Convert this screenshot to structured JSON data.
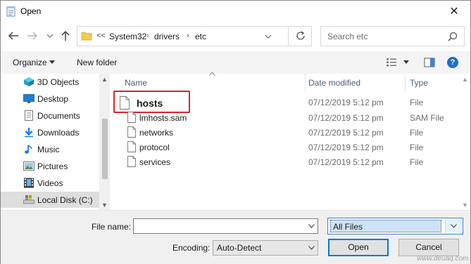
{
  "window": {
    "title": "Open"
  },
  "address": {
    "overflow": "<<",
    "crumbs": [
      "System32",
      "drivers",
      "etc"
    ]
  },
  "search": {
    "placeholder": "Search etc"
  },
  "toolbar": {
    "organize": "Organize",
    "new_folder": "New folder"
  },
  "nav": {
    "items": [
      {
        "label": "3D Objects",
        "icon": "3d-objects-icon"
      },
      {
        "label": "Desktop",
        "icon": "desktop-icon"
      },
      {
        "label": "Documents",
        "icon": "documents-icon"
      },
      {
        "label": "Downloads",
        "icon": "downloads-icon"
      },
      {
        "label": "Music",
        "icon": "music-icon"
      },
      {
        "label": "Pictures",
        "icon": "pictures-icon"
      },
      {
        "label": "Videos",
        "icon": "videos-icon"
      },
      {
        "label": "Local Disk (C:)",
        "icon": "local-disk-icon",
        "selected": true
      }
    ]
  },
  "columns": {
    "name": "Name",
    "date": "Date modified",
    "type": "Type"
  },
  "files": [
    {
      "name": "hosts",
      "date": "07/12/2019 5:12 pm",
      "type": "File",
      "highlighted": true
    },
    {
      "name": "lmhosts.sam",
      "date": "07/12/2019 5:12 pm",
      "type": "SAM File"
    },
    {
      "name": "networks",
      "date": "07/12/2019 5:12 pm",
      "type": "File"
    },
    {
      "name": "protocol",
      "date": "07/12/2019 5:12 pm",
      "type": "File"
    },
    {
      "name": "services",
      "date": "07/12/2019 5:12 pm",
      "type": "File"
    }
  ],
  "bottom": {
    "file_name_label": "File name:",
    "file_name_value": "",
    "filter_value": "All Files",
    "encoding_label": "Encoding:",
    "encoding_value": "Auto-Detect",
    "open_label": "Open",
    "cancel_label": "Cancel"
  },
  "watermark": "www.deuaq.com",
  "colors": {
    "highlight": "#d9252a",
    "accent": "#0078d7"
  }
}
